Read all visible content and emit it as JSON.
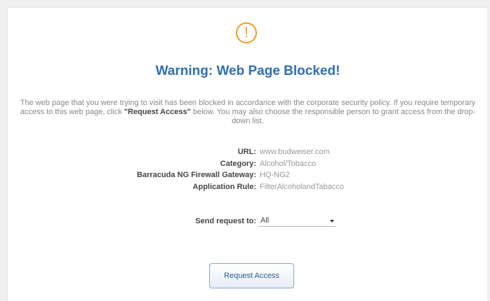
{
  "header": {
    "icon": "exclamation-circle-icon",
    "icon_glyph": "!",
    "icon_color": "#f29a1e",
    "title": "Warning: Web Page Blocked!",
    "title_color": "#2f6fb2"
  },
  "message": {
    "before": "The web page that you were trying to visit has been blocked in accordance with the corporate security policy. If you require temporary access to this web page, click ",
    "emphasis": "\"Request Access\"",
    "after": " below. You may also choose the responsible person to grant access from the drop-down list."
  },
  "details": {
    "url_label": "URL:",
    "url_value": "www.budweiser.com",
    "category_label": "Category:",
    "category_value": "Alcohol/Tobacco",
    "gateway_label": "Barracuda NG Firewall Gateway:",
    "gateway_value": "HQ-NG2",
    "rule_label": "Application Rule:",
    "rule_value": "FilterAlcoholandTabacco"
  },
  "send_request": {
    "label": "Send request to:",
    "selected": "All"
  },
  "actions": {
    "request_access_label": "Request Access"
  }
}
